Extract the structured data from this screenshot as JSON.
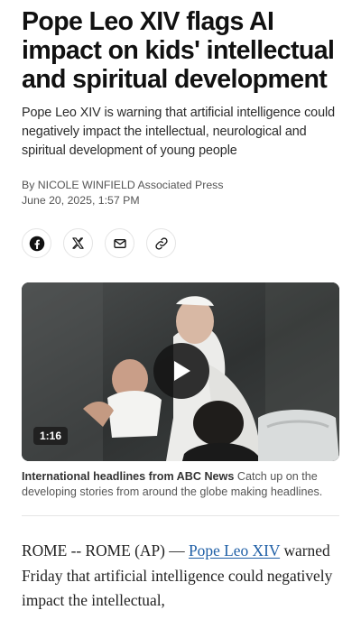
{
  "article": {
    "headline": "Pope Leo XIV flags AI impact on kids' intellectual and spiritual development",
    "dek": "Pope Leo XIV is warning that artificial intelligence could negatively impact the intellectual, neurological and spiritual development of young people",
    "byline_prefix": "By ",
    "author": "NICOLE WINFIELD",
    "publisher": " Associated Press",
    "date": "June 20, 2025, 1:57 PM"
  },
  "share": {
    "icons": [
      "facebook-icon",
      "x-icon",
      "email-icon",
      "link-icon"
    ]
  },
  "video": {
    "duration": "1:16",
    "caption_title": "International headlines from ABC News",
    "caption_text": "  Catch up on the developing stories from around the globe making headlines."
  },
  "body": {
    "lead": "ROME -- ROME (AP) — ",
    "link_text": "Pope Leo XIV",
    "rest": " warned Friday that artificial intelligence could negatively impact the intellectual,"
  },
  "colors": {
    "link": "#1f5fa6",
    "text": "#111111"
  }
}
